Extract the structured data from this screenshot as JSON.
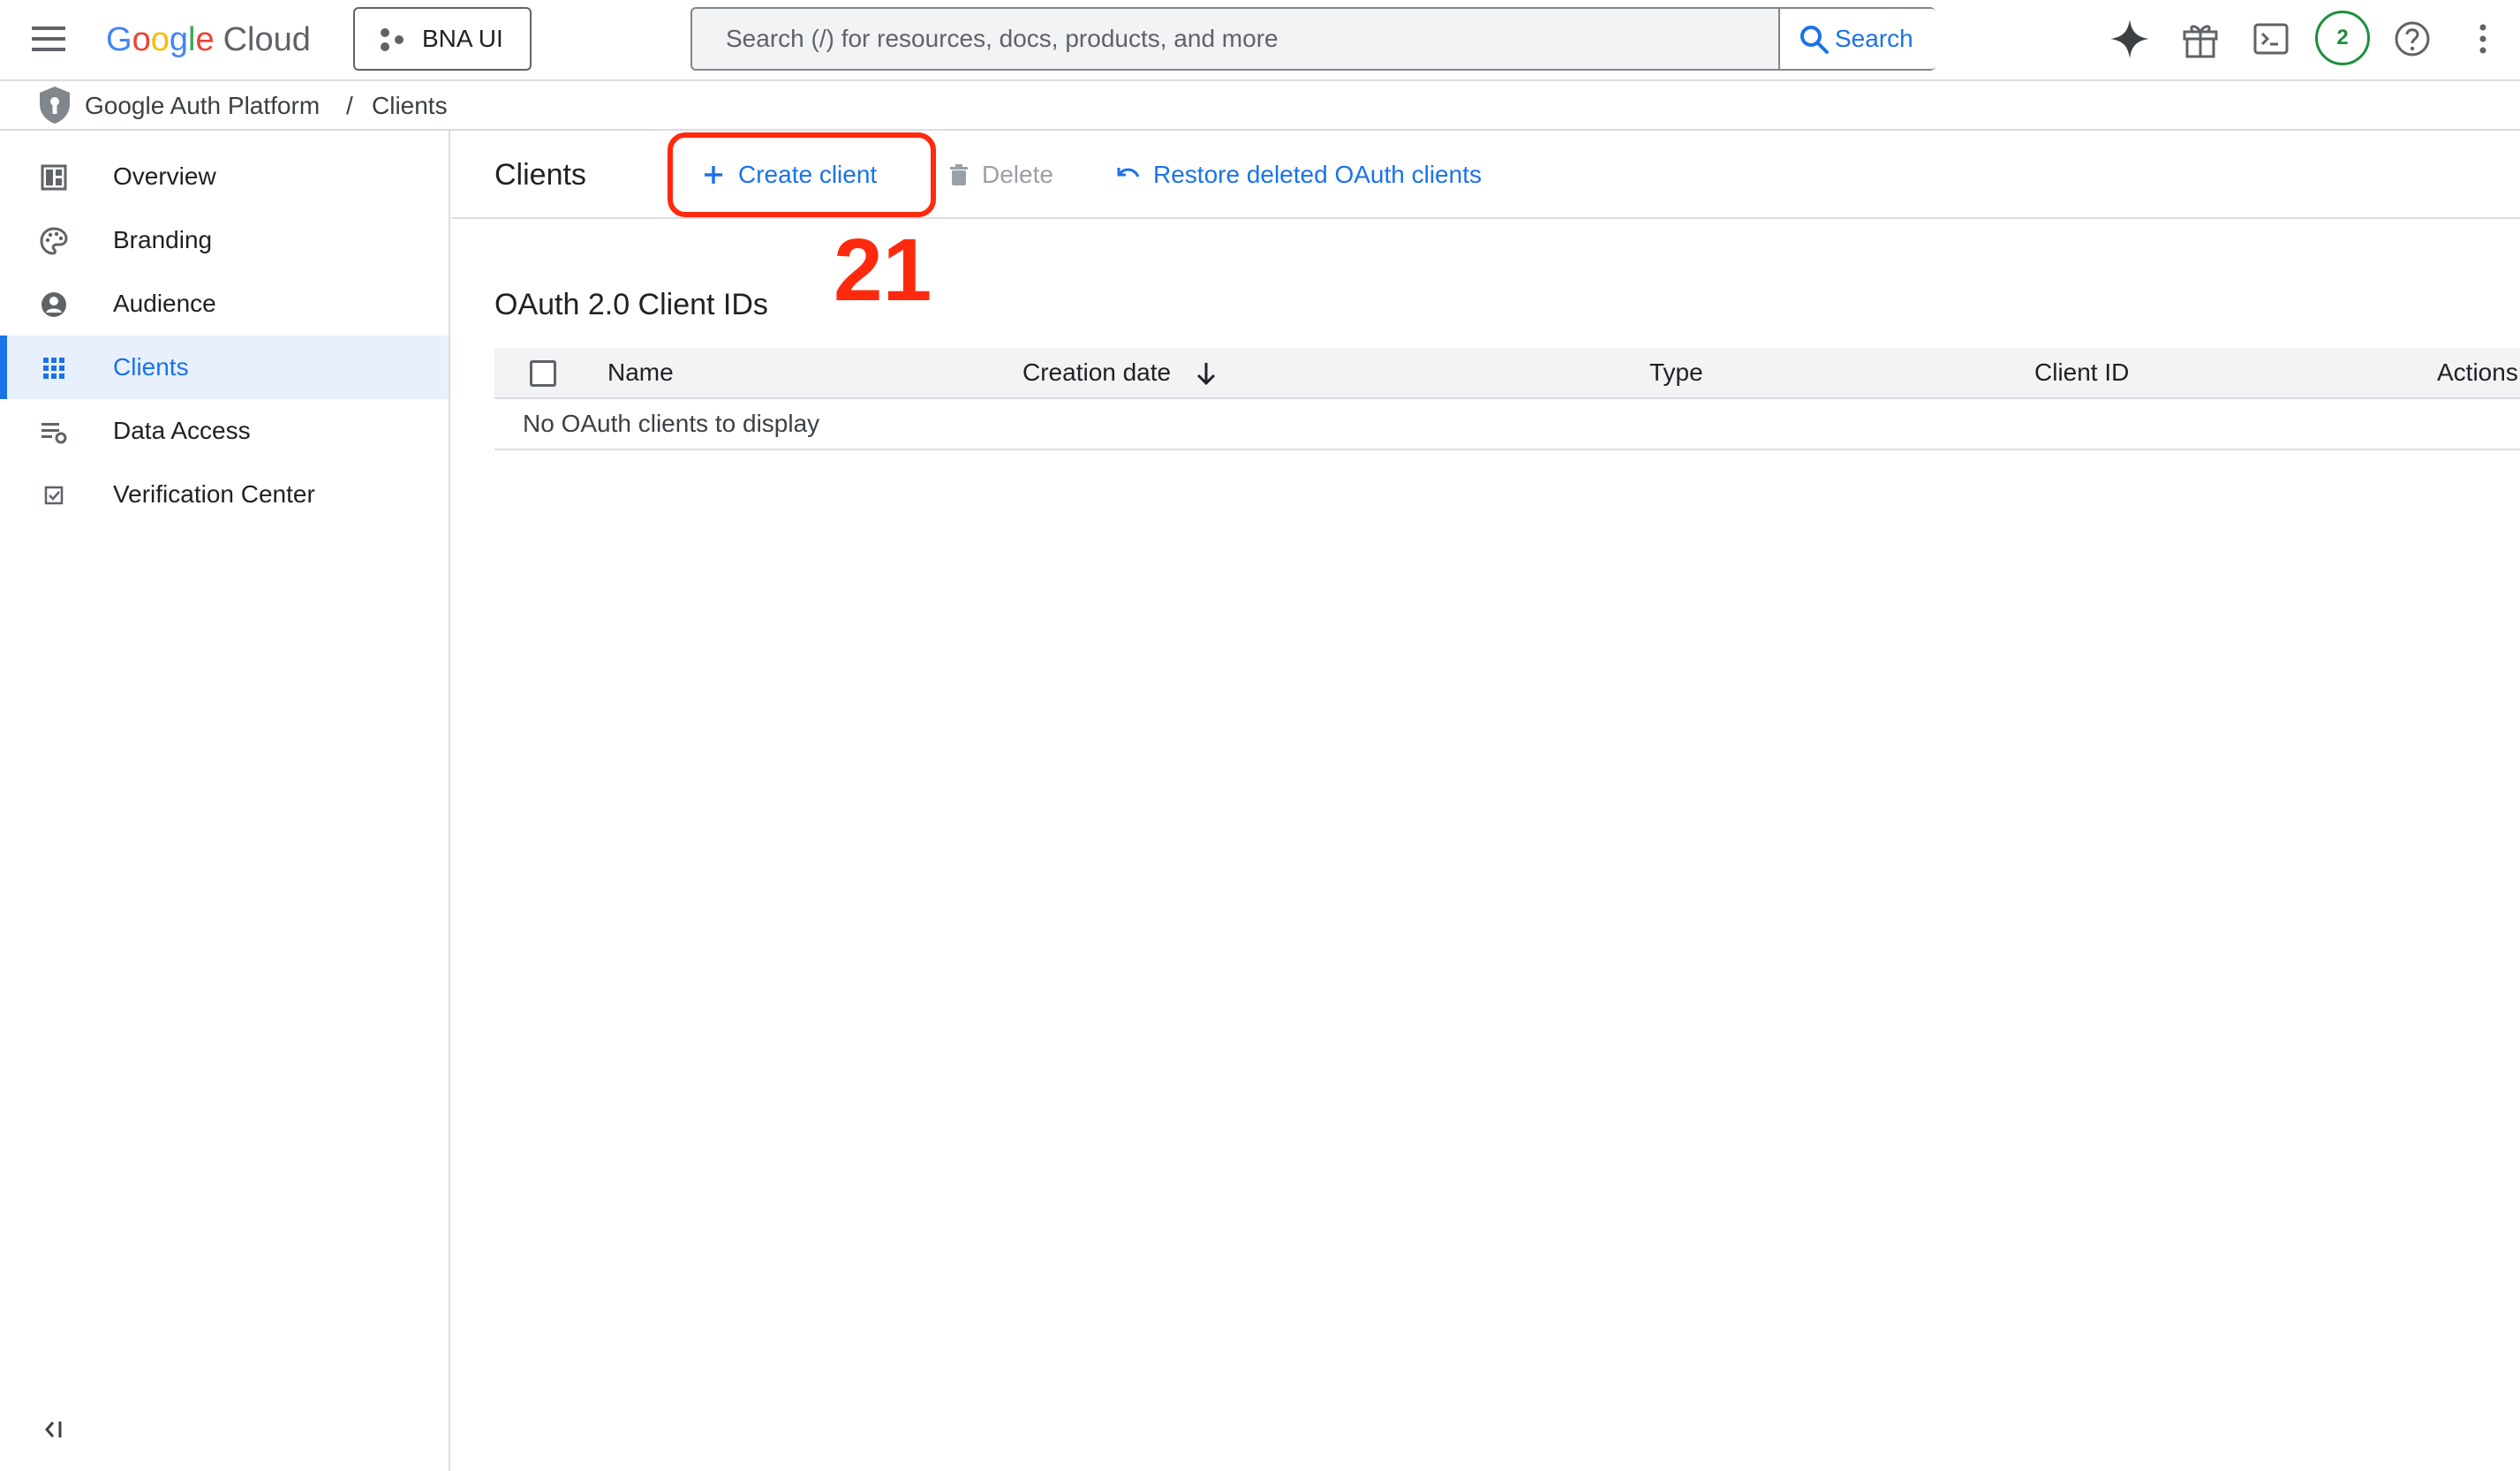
{
  "header": {
    "logo_google": [
      "G",
      "o",
      "o",
      "g",
      "l",
      "e"
    ],
    "logo_cloud": "Cloud",
    "project_name": "BNA UI",
    "search_placeholder": "Search (/) for resources, docs, products, and more",
    "search_button": "Search",
    "notification_count": "2",
    "icons": [
      "menu-icon",
      "gemini-sparkle-icon",
      "gift-icon",
      "cloud-shell-icon",
      "help-icon",
      "more-vert-icon"
    ]
  },
  "breadcrumb": {
    "items": [
      "Google Auth Platform",
      "/",
      "Clients"
    ]
  },
  "sidebar": {
    "items": [
      {
        "label": "Overview",
        "icon": "dashboard-icon",
        "active": false
      },
      {
        "label": "Branding",
        "icon": "palette-icon",
        "active": false
      },
      {
        "label": "Audience",
        "icon": "account-circle-icon",
        "active": false
      },
      {
        "label": "Clients",
        "icon": "apps-grid-icon",
        "active": true
      },
      {
        "label": "Data Access",
        "icon": "data-settings-icon",
        "active": false
      },
      {
        "label": "Verification Center",
        "icon": "verified-checkbox-icon",
        "active": false
      }
    ],
    "collapse_icon": "collapse-panel-icon"
  },
  "main": {
    "title": "Clients",
    "actions": {
      "create": "Create client",
      "delete": "Delete",
      "restore": "Restore deleted OAuth clients"
    },
    "annotation_number": "21",
    "section_title": "OAuth 2.0 Client IDs",
    "table": {
      "columns": [
        "Name",
        "Creation date",
        "Type",
        "Client ID",
        "Actions"
      ],
      "sort_column": "Creation date",
      "sort_direction": "descending",
      "empty_message": "No OAuth clients to display"
    }
  },
  "colors": {
    "accent": "#1a73e8",
    "annotation": "#ff2a0e",
    "active_bg": "#e8f0fe",
    "notification": "#1e8e3e"
  }
}
